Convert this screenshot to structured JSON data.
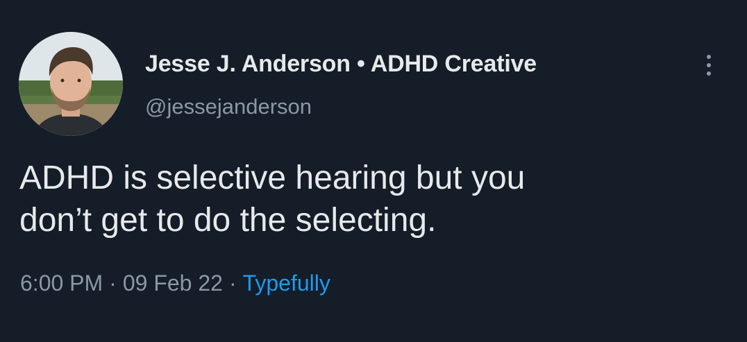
{
  "author": {
    "display_name": "Jesse J. Anderson • ADHD Creative",
    "handle": "@jessejanderson"
  },
  "tweet": {
    "text_line_1": "ADHD is selective hearing but you",
    "text_line_2": "don’t get to do the selecting."
  },
  "meta": {
    "time": "6:00 PM",
    "separator": "·",
    "date": "09 Feb 22",
    "source": "Typefully"
  },
  "colors": {
    "background": "#141d28",
    "primary_text": "#e7e9ea",
    "secondary_text": "#8b98a5",
    "link": "#1d9bf0"
  },
  "icons": {
    "more": "more-vertical-icon"
  }
}
